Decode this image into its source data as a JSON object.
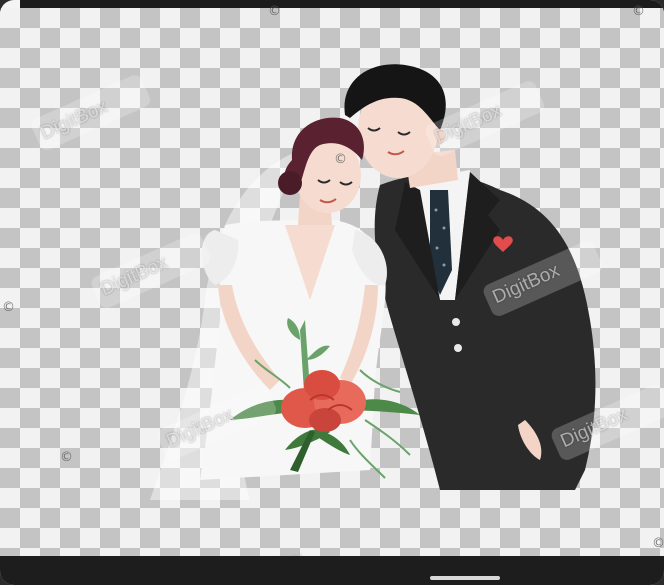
{
  "watermark": {
    "brand": "DigitBox",
    "partial": "itBox",
    "copyright_symbol": "©"
  },
  "colors": {
    "checker_dark": "#c4c4c4",
    "checker_light": "#f2f2f2",
    "suit": "#2a2a2a",
    "hair": "#5a2231",
    "dress": "#f7f7f7",
    "bouquet_flower": "#e0584a",
    "leaves": "#4d8a4a",
    "heart": "#e24c4c"
  },
  "icons": [
    "heart-icon",
    "copyright-icon"
  ]
}
